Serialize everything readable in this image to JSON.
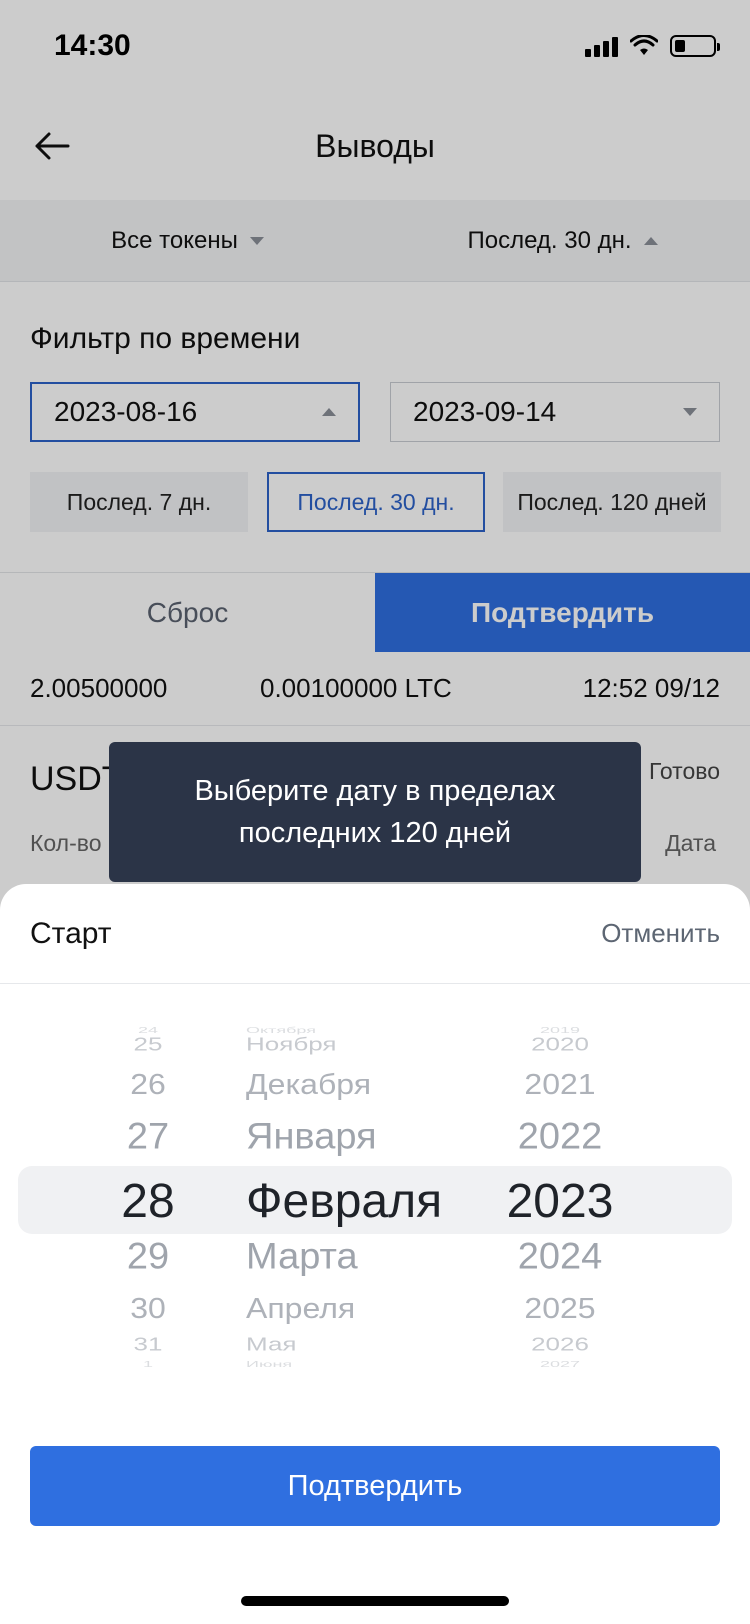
{
  "status_bar": {
    "time": "14:30"
  },
  "nav": {
    "title": "Выводы"
  },
  "filter_header": {
    "tokens_label": "Все токены",
    "period_label": "Послед. 30 дн."
  },
  "filter_panel": {
    "title": "Фильтр по времени",
    "date_from": "2023-08-16",
    "date_to": "2023-09-14",
    "presets": [
      {
        "label": "Послед. 7 дн.",
        "selected": false
      },
      {
        "label": "Послед. 30 дн.",
        "selected": true
      },
      {
        "label": "Послед. 120 дней",
        "selected": false
      }
    ],
    "reset_label": "Сброс",
    "confirm_label": "Подтвердить"
  },
  "list": {
    "partial_row": {
      "amount": "2.00500000",
      "fee": "0.00100000 LTC",
      "date": "12:52 09/12"
    },
    "card": {
      "token": "USDT",
      "status": "Готово",
      "label_left": "Кол-во",
      "label_right": "Дата"
    }
  },
  "toast": {
    "message": "Выберите дату в пределах последних 120 дней"
  },
  "sheet": {
    "title": "Старт",
    "cancel_label": "Отменить",
    "confirm_label": "Подтвердить",
    "picker": {
      "days": [
        "24",
        "25",
        "26",
        "27",
        "28",
        "29",
        "30",
        "31",
        "1"
      ],
      "months": [
        "Октября",
        "Ноября",
        "Декабря",
        "Января",
        "Февраля",
        "Марта",
        "Апреля",
        "Мая",
        "Июня"
      ],
      "years": [
        "2019",
        "2020",
        "2021",
        "2022",
        "2023",
        "2024",
        "2025",
        "2026",
        "2027"
      ],
      "selected_day": "28",
      "selected_month": "Февраля",
      "selected_year": "2023"
    }
  },
  "colors": {
    "accent": "#2f6fe0",
    "toast_bg": "#2b3447",
    "outline_active": "#2c62c9"
  }
}
